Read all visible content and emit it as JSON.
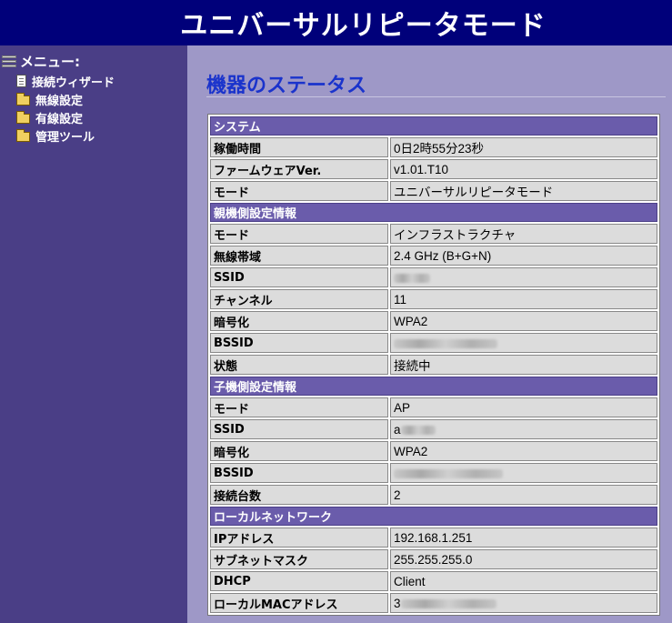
{
  "header": {
    "title": "ユニバーサルリピータモード"
  },
  "sidebar": {
    "menu_label": "メニュー:",
    "items": [
      {
        "label": "接続ウィザード",
        "icon": "document-icon"
      },
      {
        "label": "無線設定",
        "icon": "folder-icon"
      },
      {
        "label": "有線設定",
        "icon": "folder-icon"
      },
      {
        "label": "管理ツール",
        "icon": "folder-icon"
      }
    ]
  },
  "main": {
    "title": "機器のステータス",
    "sections": {
      "system": "システム",
      "parent": "親機側設定情報",
      "child": "子機側設定情報",
      "lan": "ローカルネットワーク"
    },
    "rows": {
      "uptime": {
        "key": "稼働時間",
        "value": "0日2時55分23秒"
      },
      "firmware": {
        "key": "ファームウェアVer.",
        "value": "v1.01.T10"
      },
      "mode": {
        "key": "モード",
        "value": "ユニバーサルリピータモード"
      },
      "p_mode": {
        "key": "モード",
        "value": "インフラストラクチャ"
      },
      "p_band": {
        "key": "無線帯域",
        "value": "2.4 GHz (B+G+N)"
      },
      "p_ssid": {
        "key": "SSID",
        "value": ""
      },
      "p_channel": {
        "key": "チャンネル",
        "value": "11"
      },
      "p_enc": {
        "key": "暗号化",
        "value": "WPA2"
      },
      "p_bssid": {
        "key": "BSSID",
        "value": ""
      },
      "p_state": {
        "key": "状態",
        "value": "接続中"
      },
      "c_mode": {
        "key": "モード",
        "value": "AP"
      },
      "c_ssid": {
        "key": "SSID",
        "value": "a"
      },
      "c_enc": {
        "key": "暗号化",
        "value": "WPA2"
      },
      "c_bssid": {
        "key": "BSSID",
        "value": ""
      },
      "c_clients": {
        "key": "接続台数",
        "value": "2"
      },
      "ip": {
        "key": "IPアドレス",
        "value": "192.168.1.251"
      },
      "mask": {
        "key": "サブネットマスク",
        "value": "255.255.255.0"
      },
      "dhcp": {
        "key": "DHCP",
        "value": "Client"
      },
      "mac": {
        "key": "ローカルMACアドレス",
        "value": "3"
      }
    }
  },
  "colors": {
    "header_bg": "#00007a",
    "sidebar_bg": "#4a3e86",
    "content_bg": "#9e98c7",
    "section_bg": "#6a5cab",
    "title": "#1a33cc",
    "cell_bg": "#dcdcdc"
  }
}
